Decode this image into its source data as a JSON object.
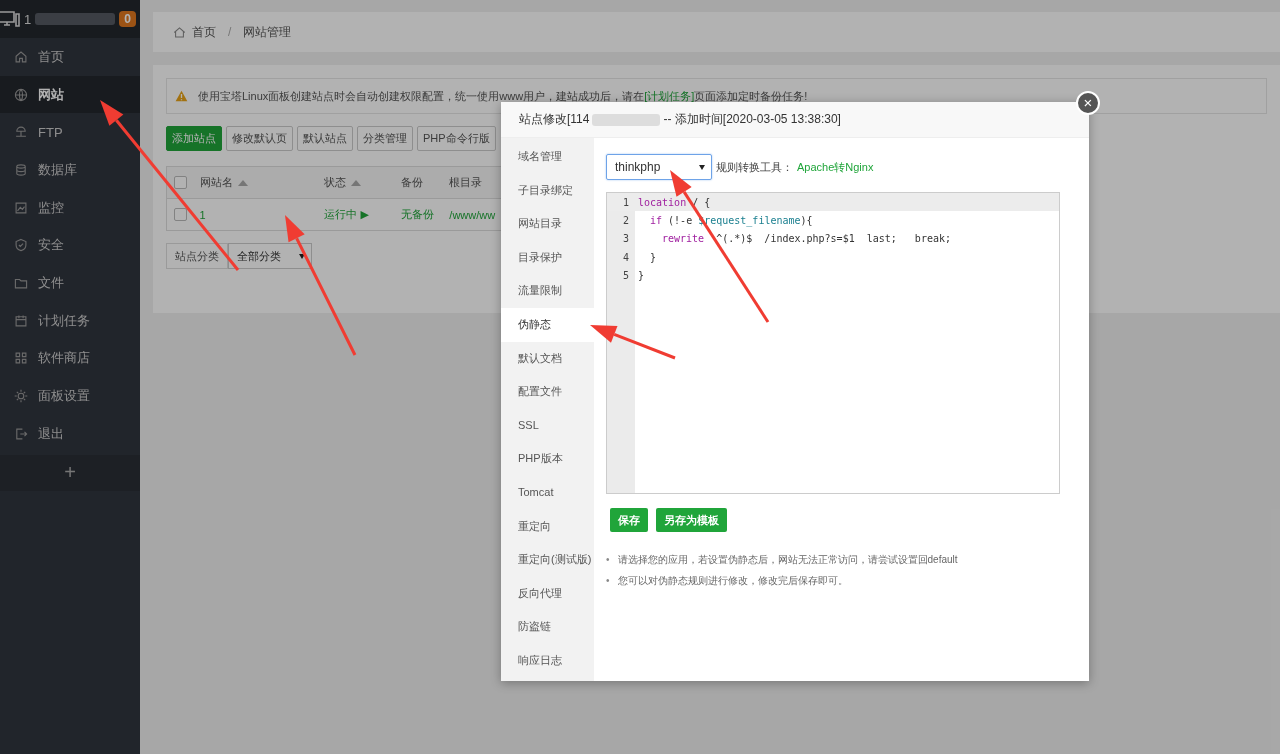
{
  "sidebar": {
    "user": "1",
    "badge": "0",
    "items": [
      {
        "label": "首页",
        "selected": false
      },
      {
        "label": "网站",
        "selected": true
      },
      {
        "label": "FTP",
        "selected": false
      },
      {
        "label": "数据库",
        "selected": false
      },
      {
        "label": "监控",
        "selected": false
      },
      {
        "label": "安全",
        "selected": false
      },
      {
        "label": "文件",
        "selected": false
      },
      {
        "label": "计划任务",
        "selected": false
      },
      {
        "label": "软件商店",
        "selected": false
      },
      {
        "label": "面板设置",
        "selected": false
      },
      {
        "label": "退出",
        "selected": false
      }
    ],
    "add": "+"
  },
  "breadcrumb": [
    "首页",
    "网站管理"
  ],
  "breadcrumb_separator": "/",
  "notice": {
    "text": "使用宝塔Linux面板创建站点时会自动创建权限配置，统一使用www用户，建站成功后，请在",
    "link": "[计划任务]",
    "after": "页面添加定时备份任务!"
  },
  "toolbar": [
    {
      "label": "添加站点",
      "primary": true
    },
    {
      "label": "修改默认页",
      "primary": false
    },
    {
      "label": "默认站点",
      "primary": false
    },
    {
      "label": "分类管理",
      "primary": false
    },
    {
      "label": "PHP命令行版",
      "primary": false
    }
  ],
  "table": {
    "columns": [
      "网站名",
      "状态",
      "备份",
      "根目录"
    ],
    "header_checked": false,
    "rows": [
      {
        "checked": false,
        "name": "1",
        "status": "运行中 ▶",
        "backup": "无备份",
        "root": "/www/ww"
      }
    ]
  },
  "category": {
    "label": "站点分类",
    "value": "全部分类"
  },
  "modal": {
    "title": "站点修改[114",
    "title_rest": "-- 添加时间[2020-03-05 13:38:30]",
    "close": "×",
    "tabs": [
      {
        "label": "域名管理",
        "selected": false
      },
      {
        "label": "子目录绑定",
        "selected": false
      },
      {
        "label": "网站目录",
        "selected": false
      },
      {
        "label": "目录保护",
        "selected": false
      },
      {
        "label": "流量限制",
        "selected": false
      },
      {
        "label": "伪静态",
        "selected": true
      },
      {
        "label": "默认文档",
        "selected": false
      },
      {
        "label": "配置文件",
        "selected": false
      },
      {
        "label": "SSL",
        "selected": false
      },
      {
        "label": "PHP版本",
        "selected": false
      },
      {
        "label": "Tomcat",
        "selected": false
      },
      {
        "label": "重定向",
        "selected": false
      },
      {
        "label": "重定向(测试版)",
        "selected": false
      },
      {
        "label": "反向代理",
        "selected": false
      },
      {
        "label": "防盗链",
        "selected": false
      },
      {
        "label": "响应日志",
        "selected": false
      }
    ],
    "select": "thinkphp",
    "tool_label": "规则转换工具：",
    "tool_link": "Apache转Nginx",
    "code": [
      {
        "number": "1",
        "active": true,
        "tokens": [
          {
            "kind": "keyword",
            "text": "location"
          },
          {
            "kind": "plain",
            "text": " / {"
          }
        ],
        "children": [
          {
            "number": "2",
            "active": false,
            "tokens": [
              {
                "kind": "keyword",
                "text": "if"
              },
              {
                "kind": "plain",
                "text": " (!-e "
              },
              {
                "kind": "variable",
                "text": "$request_filename"
              },
              {
                "kind": "plain",
                "text": "){"
              }
            ],
            "children": [
              {
                "number": "3",
                "active": false,
                "tokens": [
                  {
                    "kind": "keyword",
                    "text": "rewrite"
                  },
                  {
                    "kind": "plain",
                    "text": "  ^(.*)$  /index.php?s=$1  last;   break;"
                  }
                ]
              }
            ]
          },
          {
            "number": "4",
            "active": false,
            "tokens": [
              {
                "kind": "plain",
                "text": "}"
              }
            ]
          }
        ]
      },
      {
        "number": "5",
        "active": false,
        "tokens": [
          {
            "kind": "plain",
            "text": "}"
          }
        ]
      }
    ],
    "buttons": [
      "保存",
      "另存为模板"
    ],
    "bullet": "•",
    "notes": [
      "请选择您的应用，若设置伪静态后，网站无法正常访问，请尝试设置回default",
      "您可以对伪静态规则进行修改，修改完后保存即可。"
    ]
  }
}
